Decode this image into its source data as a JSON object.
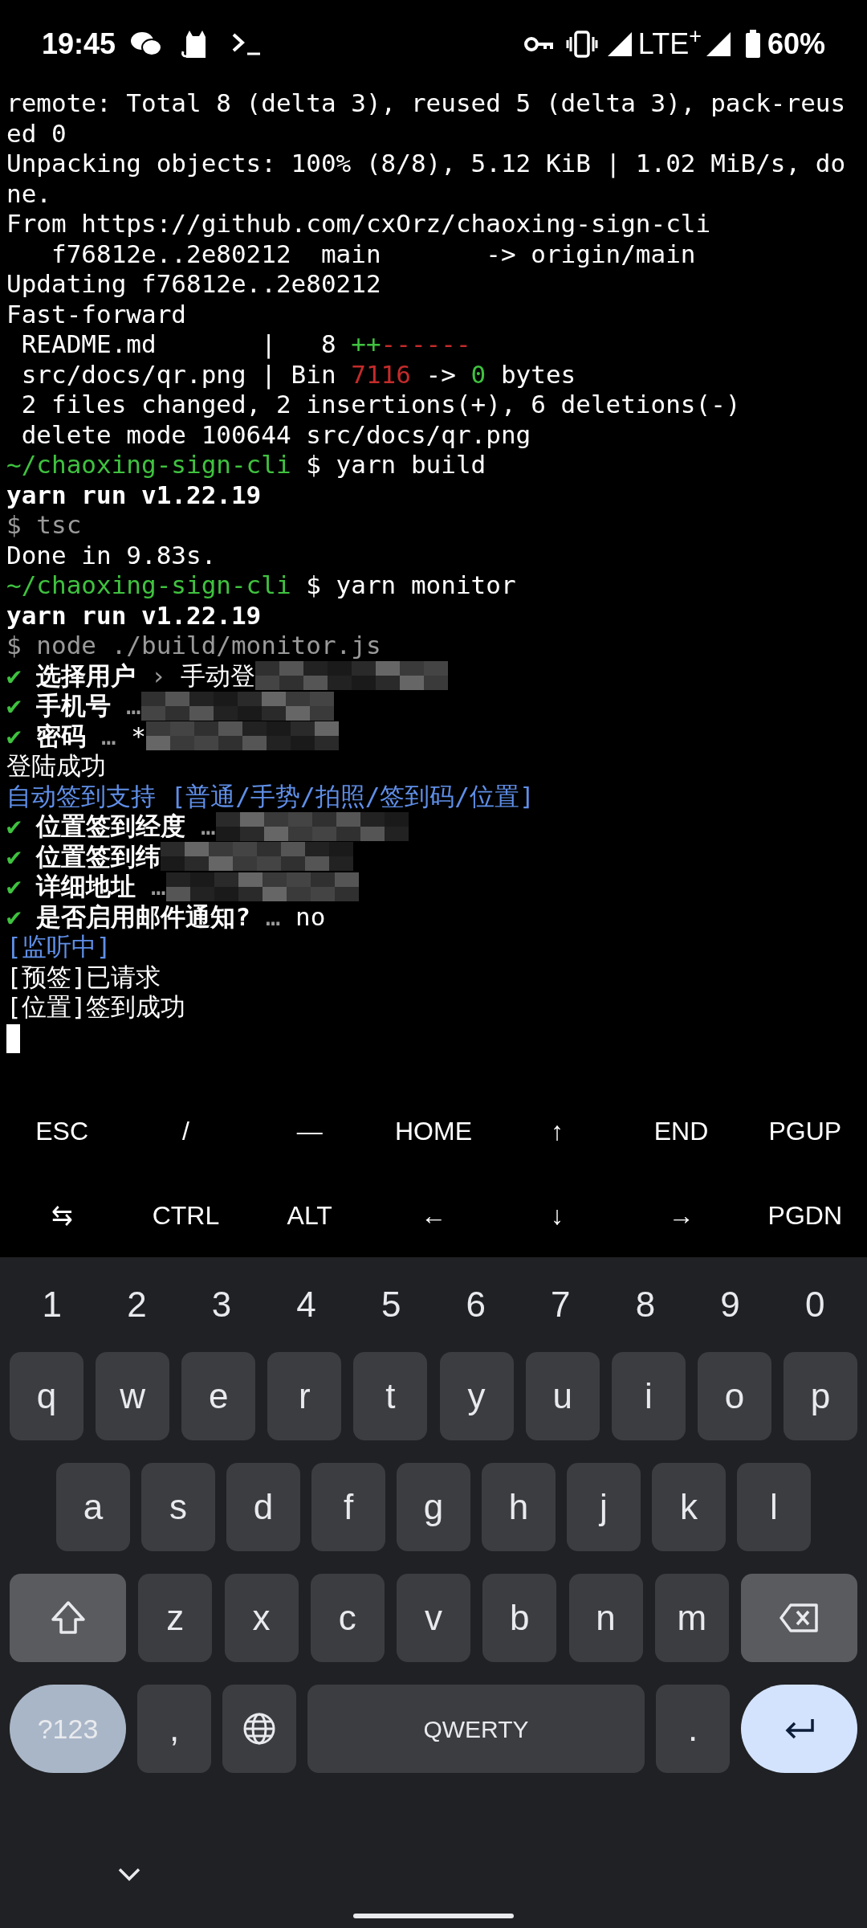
{
  "status_bar": {
    "time": "19:45",
    "network": "LTE$^{+}$",
    "battery": "60%"
  },
  "terminal": {
    "cursor": true,
    "lines": [
      {
        "segments": [
          {
            "text": "remote: Total 8 (delta 3), reused 5 (delta 3), pack-reus",
            "kind": "output"
          }
        ]
      },
      {
        "segments": [
          {
            "text": "ed 0",
            "kind": "output"
          }
        ]
      },
      {
        "segments": [
          {
            "text": "Unpacking objects: 100% (8/8), 5.12 KiB | 1.02 MiB/s, do",
            "kind": "output"
          }
        ]
      },
      {
        "segments": [
          {
            "text": "ne.",
            "kind": "output"
          }
        ]
      },
      {
        "segments": [
          {
            "text": "From https://github.com/cxOrz/chaoxing-sign-cli",
            "kind": "output"
          }
        ]
      },
      {
        "segments": [
          {
            "text": "   f76812e..2e80212  main       -> origin/main",
            "kind": "output"
          }
        ]
      },
      {
        "segments": [
          {
            "text": "Updating f76812e..2e80212",
            "kind": "output"
          }
        ]
      },
      {
        "segments": [
          {
            "text": "Fast-forward",
            "kind": "output"
          }
        ]
      },
      {
        "segments": [
          {
            "text": " README.md       |   8 ",
            "kind": "output"
          },
          {
            "text": "++",
            "kind": "added"
          },
          {
            "text": "------",
            "kind": "removed"
          }
        ]
      },
      {
        "segments": [
          {
            "text": " src/docs/qr.png | Bin ",
            "kind": "output"
          },
          {
            "text": "7116",
            "kind": "removed"
          },
          {
            "text": " -> ",
            "kind": "output"
          },
          {
            "text": "0",
            "kind": "added"
          },
          {
            "text": " bytes",
            "kind": "output"
          }
        ]
      },
      {
        "segments": [
          {
            "text": " 2 files changed, 2 insertions(+), 6 deletions(-)",
            "kind": "output"
          }
        ]
      },
      {
        "segments": [
          {
            "text": " delete mode 100644 src/docs/qr.png",
            "kind": "output"
          }
        ]
      },
      {
        "segments": [
          {
            "text": "~/chaoxing-sign-cli",
            "kind": "path"
          },
          {
            "text": " $ yarn build",
            "kind": "output"
          }
        ]
      },
      {
        "segments": [
          {
            "text": "yarn run v1.22.19",
            "kind": "heading"
          }
        ]
      },
      {
        "segments": [
          {
            "text": "$ tsc",
            "kind": "command"
          }
        ]
      },
      {
        "segments": [
          {
            "text": "Done in 9.83s.",
            "kind": "output"
          }
        ]
      },
      {
        "segments": [
          {
            "text": "~/chaoxing-sign-cli",
            "kind": "path"
          },
          {
            "text": " $ yarn monitor",
            "kind": "output"
          }
        ]
      },
      {
        "segments": [
          {
            "text": "yarn run v1.22.19",
            "kind": "heading"
          }
        ]
      },
      {
        "segments": [
          {
            "text": "$ node ./build/monitor.js",
            "kind": "command"
          }
        ]
      },
      {
        "segments": [
          {
            "text": "✔",
            "kind": "check"
          },
          {
            "text": " 选择用户",
            "kind": "heading"
          },
          {
            "text": " › ",
            "kind": "command"
          },
          {
            "text": "手动登",
            "kind": "output"
          },
          {
            "kind": "redacted"
          }
        ]
      },
      {
        "segments": [
          {
            "text": "✔",
            "kind": "check"
          },
          {
            "text": " 手机号",
            "kind": "heading"
          },
          {
            "text": " …",
            "kind": "command"
          },
          {
            "kind": "redacted"
          }
        ]
      },
      {
        "segments": [
          {
            "text": "✔",
            "kind": "check"
          },
          {
            "text": " 密码",
            "kind": "heading"
          },
          {
            "text": " …",
            "kind": "command"
          },
          {
            "text": " *",
            "kind": "output"
          },
          {
            "kind": "redacted"
          }
        ]
      },
      {
        "segments": [
          {
            "text": "登陆成功",
            "kind": "output"
          }
        ]
      },
      {
        "segments": [
          {
            "text": "自动签到支持 [普通/手势/拍照/签到码/位置]",
            "kind": "info"
          }
        ]
      },
      {
        "segments": [
          {
            "text": "✔",
            "kind": "check"
          },
          {
            "text": " 位置签到经度",
            "kind": "heading"
          },
          {
            "text": " …",
            "kind": "command"
          },
          {
            "kind": "redacted"
          }
        ]
      },
      {
        "segments": [
          {
            "text": "✔",
            "kind": "check"
          },
          {
            "text": " 位置签到纬",
            "kind": "heading"
          },
          {
            "kind": "redacted"
          }
        ]
      },
      {
        "segments": [
          {
            "text": "✔",
            "kind": "check"
          },
          {
            "text": " 详细地址",
            "kind": "heading"
          },
          {
            "text": " …",
            "kind": "command"
          },
          {
            "kind": "redacted"
          }
        ]
      },
      {
        "segments": [
          {
            "text": "✔",
            "kind": "check"
          },
          {
            "text": " 是否启用邮件通知?",
            "kind": "heading"
          },
          {
            "text": " …",
            "kind": "command"
          },
          {
            "text": " no",
            "kind": "output"
          }
        ]
      },
      {
        "segments": [
          {
            "text": "[监听中]",
            "kind": "info"
          }
        ]
      },
      {
        "segments": [
          {
            "text": "[预签]已请求",
            "kind": "output"
          }
        ]
      },
      {
        "segments": [
          {
            "text": "[位置]签到成功",
            "kind": "output"
          }
        ]
      }
    ]
  },
  "extra_keys": {
    "upper_row": [
      {
        "label": "ESC"
      },
      {
        "label": "/"
      },
      {
        "label": "—"
      },
      {
        "label": "HOME"
      },
      {
        "label": "↑"
      },
      {
        "label": "END"
      },
      {
        "label": "PGUP"
      }
    ],
    "lower_row": [
      {
        "label": "⇆"
      },
      {
        "label": "CTRL"
      },
      {
        "label": "ALT"
      },
      {
        "label": "←"
      },
      {
        "label": "↓"
      },
      {
        "label": "→"
      },
      {
        "label": "PGDN"
      }
    ]
  },
  "keyboard": {
    "number_row": [
      "1",
      "2",
      "3",
      "4",
      "5",
      "6",
      "7",
      "8",
      "9",
      "0"
    ],
    "top_letters": [
      {
        "kind": "char",
        "label": "q"
      },
      {
        "kind": "char",
        "label": "w"
      },
      {
        "kind": "char",
        "label": "e"
      },
      {
        "kind": "char",
        "label": "r"
      },
      {
        "kind": "char",
        "label": "t"
      },
      {
        "kind": "char",
        "label": "y"
      },
      {
        "kind": "char",
        "label": "u"
      },
      {
        "kind": "char",
        "label": "i"
      },
      {
        "kind": "char",
        "label": "o"
      },
      {
        "kind": "char",
        "label": "p"
      }
    ],
    "home_letters": [
      {
        "kind": "char",
        "label": "a"
      },
      {
        "kind": "char",
        "label": "s"
      },
      {
        "kind": "char",
        "label": "d"
      },
      {
        "kind": "char",
        "label": "f"
      },
      {
        "kind": "char",
        "label": "g"
      },
      {
        "kind": "char",
        "label": "h"
      },
      {
        "kind": "char",
        "label": "j"
      },
      {
        "kind": "char",
        "label": "k"
      },
      {
        "kind": "char",
        "label": "l"
      }
    ],
    "bottom_letters": [
      {
        "kind": "shift"
      },
      {
        "kind": "char",
        "label": "z"
      },
      {
        "kind": "char",
        "label": "x"
      },
      {
        "kind": "char",
        "label": "c"
      },
      {
        "kind": "char",
        "label": "v"
      },
      {
        "kind": "char",
        "label": "b"
      },
      {
        "kind": "char",
        "label": "n"
      },
      {
        "kind": "char",
        "label": "m"
      },
      {
        "kind": "backspace"
      }
    ],
    "function_keys": [
      {
        "kind": "symbols",
        "label": "?123"
      },
      {
        "kind": "char",
        "label": ","
      },
      {
        "kind": "globe"
      },
      {
        "kind": "space",
        "label": "QWERTY"
      },
      {
        "kind": "char",
        "label": "."
      },
      {
        "kind": "enter"
      }
    ]
  }
}
